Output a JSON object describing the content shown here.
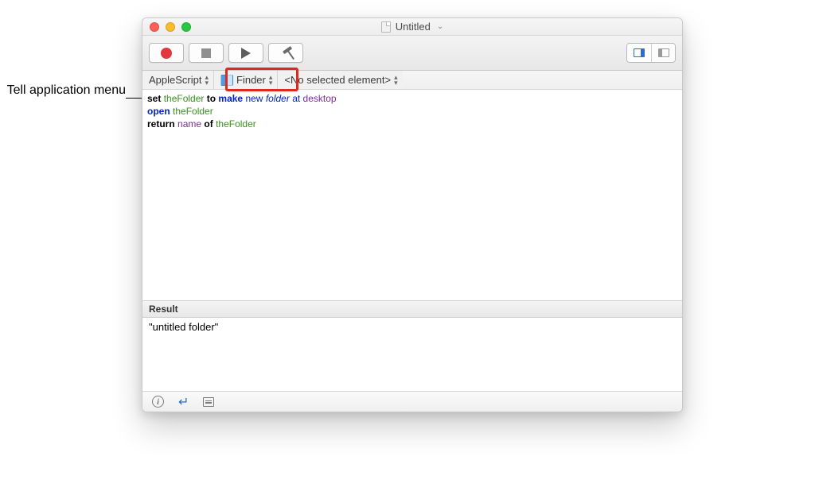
{
  "annotation": "Tell application menu",
  "window": {
    "title": "Untitled"
  },
  "toolbar": {
    "record": "Record",
    "stop": "Stop",
    "run": "Run",
    "compile": "Compile"
  },
  "navbar": {
    "language": "AppleScript",
    "target": "Finder",
    "element": "<No selected element>"
  },
  "code": {
    "line1": {
      "t1": "set",
      "t2": "theFolder",
      "t3": "to",
      "t4": "make",
      "t5": "new",
      "t6": "folder",
      "t7": "at",
      "t8": "desktop"
    },
    "line2": {
      "t1": "open",
      "t2": "theFolder"
    },
    "line3": {
      "t1": "return",
      "t2": "name",
      "t3": "of",
      "t4": "theFolder"
    }
  },
  "result": {
    "header": "Result",
    "value": "\"untitled folder\""
  }
}
